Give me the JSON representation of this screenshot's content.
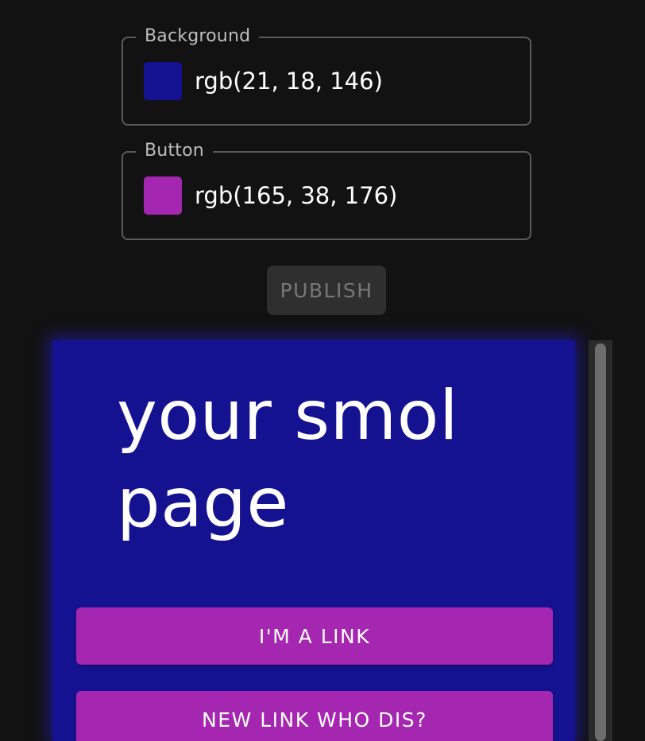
{
  "colors": {
    "page_bg": "#121212",
    "background": "#151292",
    "button": "#a526b0"
  },
  "fields": {
    "background": {
      "label": "Background",
      "value": "rgb(21, 18, 146)",
      "swatch_color": "#151292"
    },
    "button": {
      "label": "Button",
      "value": "rgb(165, 38, 176)",
      "swatch_color": "#a526b0"
    }
  },
  "publish": {
    "label": "PUBLISH",
    "disabled": true
  },
  "preview": {
    "title": "your smol page",
    "links": [
      {
        "label": "I'M A LINK"
      },
      {
        "label": "NEW LINK WHO DIS?"
      }
    ]
  }
}
